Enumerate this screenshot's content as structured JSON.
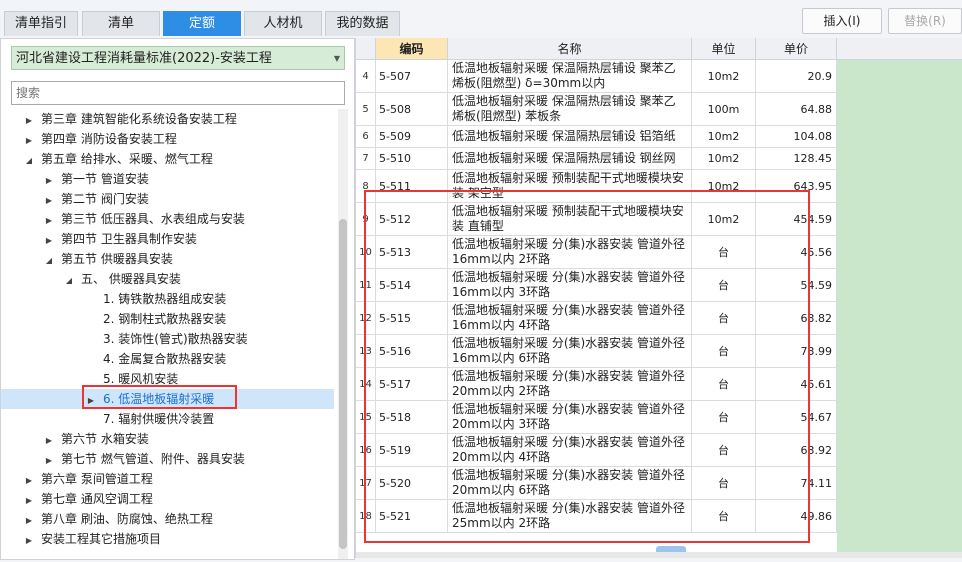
{
  "tabs": [
    {
      "label": "清单指引",
      "active": false
    },
    {
      "label": "清单",
      "active": false
    },
    {
      "label": "定额",
      "active": true
    },
    {
      "label": "人材机",
      "active": false
    },
    {
      "label": "我的数据",
      "active": false
    }
  ],
  "buttons": {
    "insert": "插入(I)",
    "replace": "替换(R)"
  },
  "library": {
    "selected": "河北省建设工程消耗量标准(2022)-安装工程"
  },
  "search": {
    "placeholder": "搜索"
  },
  "tree": [
    {
      "label": "第三章 建筑智能化系统设备安装工程",
      "level": 1,
      "expanded": false
    },
    {
      "label": "第四章 消防设备安装工程",
      "level": 1,
      "expanded": false
    },
    {
      "label": "第五章 给排水、采暖、燃气工程",
      "level": 1,
      "expanded": true
    },
    {
      "label": "第一节 管道安装",
      "level": 2,
      "expanded": false
    },
    {
      "label": "第二节 阀门安装",
      "level": 2,
      "expanded": false
    },
    {
      "label": "第三节 低压器具、水表组成与安装",
      "level": 2,
      "expanded": false
    },
    {
      "label": "第四节 卫生器具制作安装",
      "level": 2,
      "expanded": false
    },
    {
      "label": "第五节 供暖器具安装",
      "level": 2,
      "expanded": true
    },
    {
      "label": "五、  供暖器具安装",
      "level": 3,
      "expanded": true
    },
    {
      "label": "1. 铸铁散热器组成安装",
      "level": 4,
      "leaf": true
    },
    {
      "label": "2. 钢制柱式散热器安装",
      "level": 4,
      "leaf": true
    },
    {
      "label": "3. 装饰性(管式)散热器安装",
      "level": 4,
      "leaf": true
    },
    {
      "label": "4. 金属复合散热器安装",
      "level": 4,
      "leaf": true
    },
    {
      "label": "5. 暖风机安装",
      "level": 4,
      "leaf": true
    },
    {
      "label": "6. 低温地板辐射采暖",
      "level": 4,
      "selected": true,
      "expanded": false
    },
    {
      "label": "7. 辐射供暖供冷装置",
      "level": 4,
      "leaf": true
    },
    {
      "label": "第六节 水箱安装",
      "level": 2,
      "expanded": false
    },
    {
      "label": "第七节 燃气管道、附件、器具安装",
      "level": 2,
      "expanded": false
    },
    {
      "label": "第六章 泵间管道工程",
      "level": 1,
      "expanded": false
    },
    {
      "label": "第七章 通风空调工程",
      "level": 1,
      "expanded": false
    },
    {
      "label": "第八章 刷油、防腐蚀、绝热工程",
      "level": 1,
      "expanded": false
    },
    {
      "label": "安装工程其它措施项目",
      "level": 1,
      "expanded": false
    }
  ],
  "table": {
    "headers": {
      "code": "编码",
      "name": "名称",
      "unit": "单位",
      "price": "单价"
    },
    "rows": [
      {
        "idx": "4",
        "code": "5-507",
        "name": "低温地板辐射采暖 保温隔热层铺设 聚苯乙烯板(阻燃型) δ=30mm以内",
        "unit": "10m2",
        "price": "20.9"
      },
      {
        "idx": "5",
        "code": "5-508",
        "name": "低温地板辐射采暖 保温隔热层铺设 聚苯乙烯板(阻燃型) 苯板条",
        "unit": "100m",
        "price": "64.88"
      },
      {
        "idx": "6",
        "code": "5-509",
        "name": "低温地板辐射采暖 保温隔热层铺设 铝箔纸",
        "unit": "10m2",
        "price": "104.08"
      },
      {
        "idx": "7",
        "code": "5-510",
        "name": "低温地板辐射采暖 保温隔热层铺设 钢丝网",
        "unit": "10m2",
        "price": "128.45"
      },
      {
        "idx": "8",
        "code": "5-511",
        "name": "低温地板辐射采暖 预制装配干式地暖模块安装 架空型",
        "unit": "10m2",
        "price": "643.95"
      },
      {
        "idx": "9",
        "code": "5-512",
        "name": "低温地板辐射采暖 预制装配干式地暖模块安装 直铺型",
        "unit": "10m2",
        "price": "454.59"
      },
      {
        "idx": "10",
        "code": "5-513",
        "name": "低温地板辐射采暖 分(集)水器安装 管道外径16mm以内 2环路",
        "unit": "台",
        "price": "45.56"
      },
      {
        "idx": "11",
        "code": "5-514",
        "name": "低温地板辐射采暖 分(集)水器安装 管道外径16mm以内 3环路",
        "unit": "台",
        "price": "54.59"
      },
      {
        "idx": "12",
        "code": "5-515",
        "name": "低温地板辐射采暖 分(集)水器安装 管道外径16mm以内 4环路",
        "unit": "台",
        "price": "63.82"
      },
      {
        "idx": "13",
        "code": "5-516",
        "name": "低温地板辐射采暖 分(集)水器安装 管道外径16mm以内 6环路",
        "unit": "台",
        "price": "73.99"
      },
      {
        "idx": "14",
        "code": "5-517",
        "name": "低温地板辐射采暖 分(集)水器安装 管道外径20mm以内 2环路",
        "unit": "台",
        "price": "45.61"
      },
      {
        "idx": "15",
        "code": "5-518",
        "name": "低温地板辐射采暖 分(集)水器安装 管道外径20mm以内 3环路",
        "unit": "台",
        "price": "54.67"
      },
      {
        "idx": "16",
        "code": "5-519",
        "name": "低温地板辐射采暖 分(集)水器安装 管道外径20mm以内 4环路",
        "unit": "台",
        "price": "63.92"
      },
      {
        "idx": "17",
        "code": "5-520",
        "name": "低温地板辐射采暖 分(集)水器安装 管道外径20mm以内 6环路",
        "unit": "台",
        "price": "74.11"
      },
      {
        "idx": "18",
        "code": "5-521",
        "name": "低温地板辐射采暖 分(集)水器安装 管道外径25mm以内 2环路",
        "unit": "台",
        "price": "49.86"
      }
    ]
  },
  "colors": {
    "active_tab": "#2e8ee6",
    "highlight_box": "#e33333",
    "library_bg": "#d6ecd6",
    "price_column_bg": "#cbe7cb"
  }
}
